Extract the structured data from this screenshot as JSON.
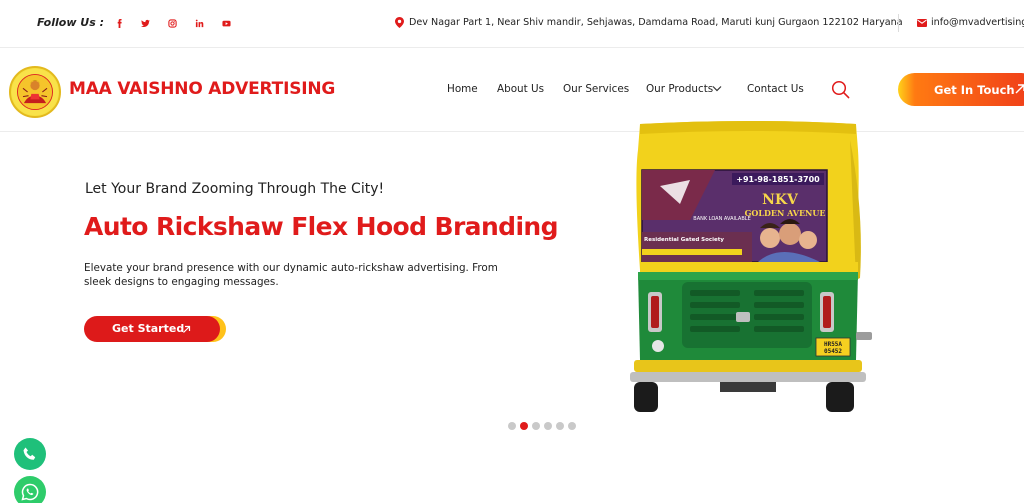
{
  "topbar": {
    "follow_label": "Follow Us :",
    "social_icons": [
      "facebook-icon",
      "twitter-icon",
      "instagram-icon",
      "linkedin-icon",
      "youtube-icon"
    ],
    "address": "Dev Nagar Part 1, Near Shiv mandir, Sehjawas, Damdama Road, Maruti kunj Gurgaon 122102 Haryana",
    "email": "info@mvadvertising"
  },
  "header": {
    "brand": "MAA VAISHNO ADVERTISING",
    "nav": [
      "Home",
      "About Us",
      "Our Services",
      "Our Products",
      "Contact Us"
    ],
    "cta_label": "Get In Touch"
  },
  "hero": {
    "tagline": "Let Your Brand Zooming Through The City!",
    "headline": "Auto Rickshaw Flex Hood Branding",
    "description": "Elevate your brand presence with our dynamic auto-rickshaw advertising. From sleek designs to engaging messages.",
    "button_label": "Get Started",
    "banner": {
      "phone": "+91-98-1851-3700",
      "title": "NKV",
      "subtitle": "GOLDEN AVENUE",
      "loan": "BANK LOAN AVAILABLE",
      "society": "Residential Gated Society"
    },
    "plate": "HR55A 05452"
  },
  "slider": {
    "count": 6,
    "active_index": 1
  },
  "colors": {
    "brand_red": "#e01b1b",
    "accent_orange": "#ff7a12",
    "accent_yellow": "#ffc21a",
    "whatsapp_green": "#2ecc6a"
  }
}
